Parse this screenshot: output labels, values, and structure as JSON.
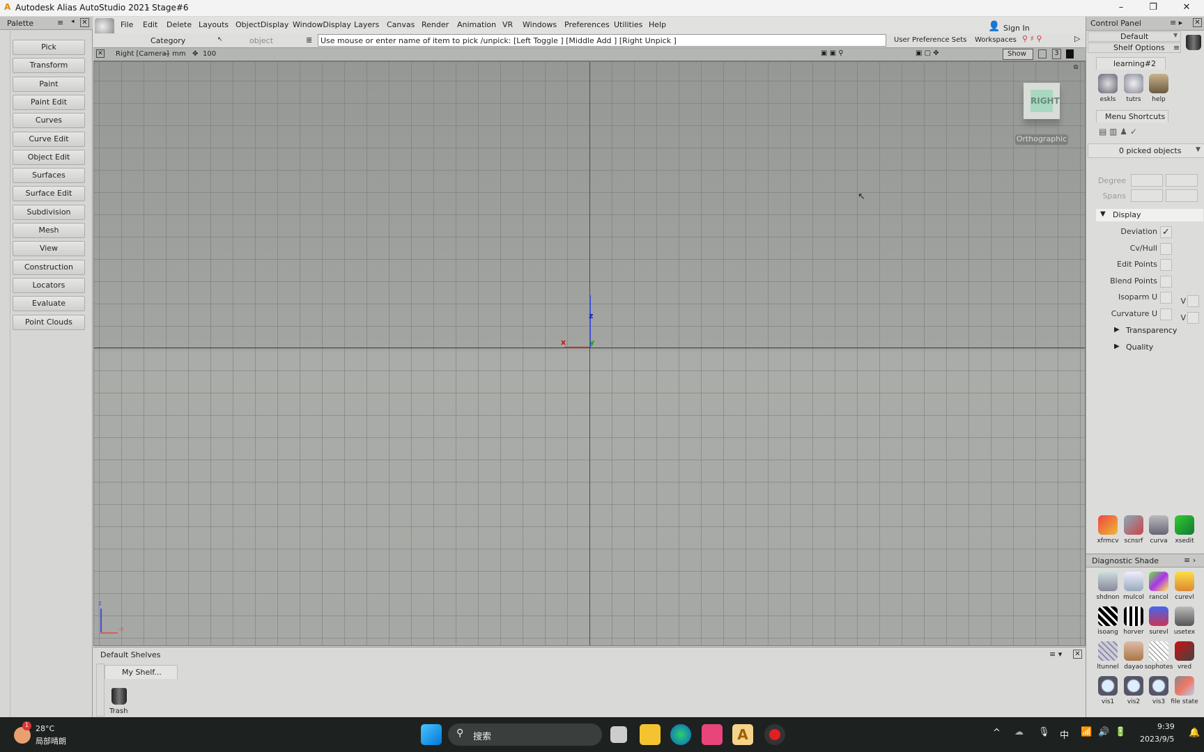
{
  "window": {
    "app_title": "Autodesk Alias AutoStudio 2021",
    "doc_title": "- Stage#6",
    "minimize": "–",
    "restore": "❐",
    "close": "✕"
  },
  "palette": {
    "title": "Palette",
    "items": [
      "Pick",
      "Transform",
      "Paint",
      "Paint Edit",
      "Curves",
      "Curve Edit",
      "Object Edit",
      "Surfaces",
      "Surface Edit",
      "Subdivision",
      "Mesh",
      "View",
      "Construction",
      "Locators",
      "Evaluate",
      "Point Clouds"
    ]
  },
  "menubar": {
    "object_label": "object",
    "items": [
      "File",
      "Edit",
      "Delete",
      "Layouts",
      "ObjectDisplay",
      "WindowDisplay",
      "Layers",
      "Canvas",
      "Render",
      "Animation",
      "VR",
      "Windows",
      "Preferences",
      "Utilities",
      "Help"
    ],
    "sign_in": "Sign In"
  },
  "toolbar": {
    "category": "Category",
    "object_placeholder": "object",
    "prompt": "Use mouse or enter name of item to pick /unpick: [Left Toggle ] [Middle Add ] [Right Unpick ]",
    "user_pref": "User Preference Sets",
    "workspaces": "Workspaces"
  },
  "viewport": {
    "camera": "Right [Camera]",
    "units": "— mm",
    "scale": "100",
    "show": "Show",
    "layer_num": "3",
    "viewcube": "RIGHT",
    "projection": "Orthographic",
    "axis_z": "z",
    "axis_x": "x",
    "axis_y": "y",
    "triad_z": "z",
    "triad_x": "-x"
  },
  "shelf": {
    "title": "Default Shelves",
    "tab": "My Shelf...",
    "trash": "Trash"
  },
  "control_panel": {
    "title": "Control Panel",
    "preset": "Default",
    "shelf_options": "Shelf Options",
    "shelf_tab": "learning#2",
    "shelf_tools": [
      "eskls",
      "tutrs",
      "help"
    ],
    "menu_shortcuts": "Menu Shortcuts",
    "picked": "0 picked objects",
    "degree": "Degree",
    "spans": "Spans",
    "display": "Display",
    "options": [
      {
        "label": "Deviation",
        "checked": true
      },
      {
        "label": "Cv/Hull",
        "checked": false
      },
      {
        "label": "Edit Points",
        "checked": false
      },
      {
        "label": "Blend Points",
        "checked": false
      },
      {
        "label": "Isoparm U",
        "checked": false
      },
      {
        "label": "Curvature U",
        "checked": false
      }
    ],
    "v_label": "V",
    "transparency": "Transparency",
    "quality": "Quality",
    "tools2": [
      "xfrmcv",
      "scnsrf",
      "curva",
      "xsedit"
    ]
  },
  "diagnostic": {
    "title": "Diagnostic Shade",
    "tools": [
      "shdnon",
      "mulcol",
      "rancol",
      "curevl",
      "isoang",
      "horver",
      "surevl",
      "usetex",
      "ltunnel",
      "dayao",
      "sophotes",
      "vred",
      "vis1",
      "vis2",
      "vis3",
      "file state"
    ]
  },
  "taskbar": {
    "temp": "28°C",
    "weather": "局部晴朗",
    "badge": "1",
    "search": "搜索",
    "time": "9:39",
    "date": "2023/9/5",
    "ime": "中"
  }
}
